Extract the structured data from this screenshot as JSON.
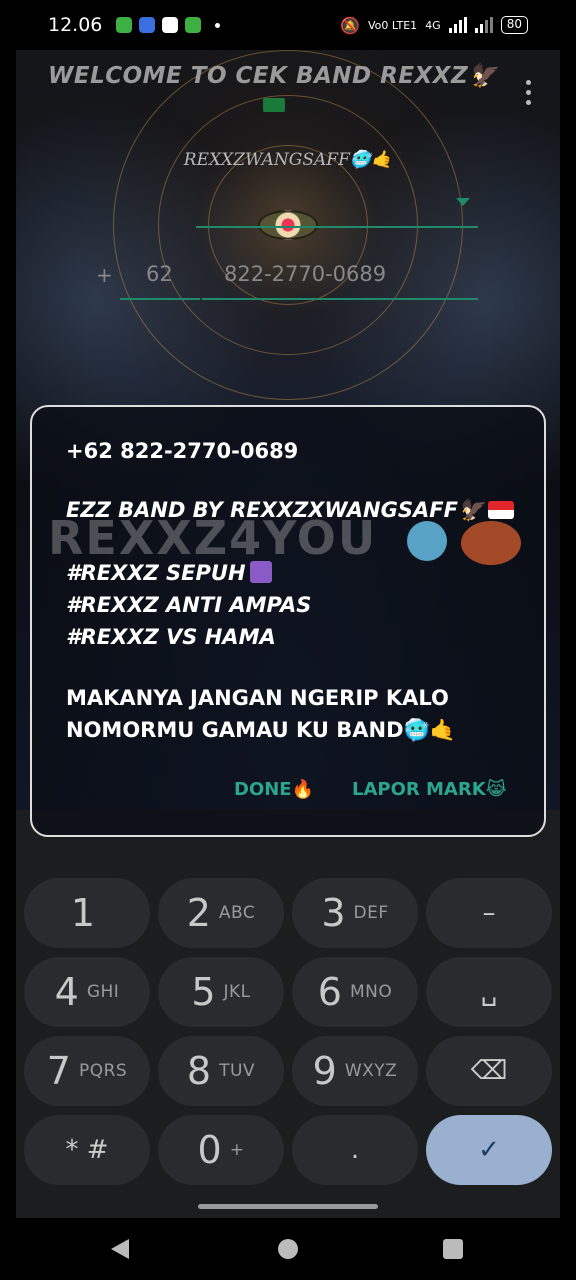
{
  "status_bar": {
    "time": "12.06",
    "network_label": "Vo0 LTE1",
    "network_type": "4G",
    "battery": "80"
  },
  "app": {
    "title": "WELCOME TO CEK BAND REXXZ🦅",
    "owner_label": "REXXZWANGSAFF🥶🤙",
    "country_placeholder": "",
    "country_code": "62",
    "phone_number": "822-2770-0689"
  },
  "dialog": {
    "watermark": "REXXZ4YOU",
    "number": "+62 822-2770-0689",
    "line1": "EZZ BAND BY REXXZXWANGSAFF🦅",
    "line2": "#REXXZ SEPUH",
    "line3": "#REXXZ ANTI AMPAS",
    "line4": "#REXXZ VS HAMA",
    "line5": "MAKANYA JANGAN NGERIP KALO",
    "line6": "NOMORMU GAMAU KU BAND🥶🤙",
    "done_label": "DONE🔥",
    "report_label": "LAPOR MARK😹"
  },
  "keypad": {
    "keys": [
      {
        "digit": "1",
        "letters": ""
      },
      {
        "digit": "2",
        "letters": "ABC"
      },
      {
        "digit": "3",
        "letters": "DEF"
      },
      {
        "digit": "–",
        "letters": ""
      },
      {
        "digit": "4",
        "letters": "GHI"
      },
      {
        "digit": "5",
        "letters": "JKL"
      },
      {
        "digit": "6",
        "letters": "MNO"
      },
      {
        "digit": "␣",
        "letters": ""
      },
      {
        "digit": "7",
        "letters": "PQRS"
      },
      {
        "digit": "8",
        "letters": "TUV"
      },
      {
        "digit": "9",
        "letters": "WXYZ"
      },
      {
        "digit": "⌫",
        "letters": ""
      },
      {
        "digit": "* #",
        "letters": ""
      },
      {
        "digit": "0",
        "letters": "+"
      },
      {
        "digit": ".",
        "letters": ""
      },
      {
        "digit": "✓",
        "letters": ""
      }
    ]
  },
  "colors": {
    "accent": "#2ca58d",
    "underline": "#1f8a6a",
    "done_key": "#9ab0cf",
    "key_bg": "#2a2b2e"
  }
}
